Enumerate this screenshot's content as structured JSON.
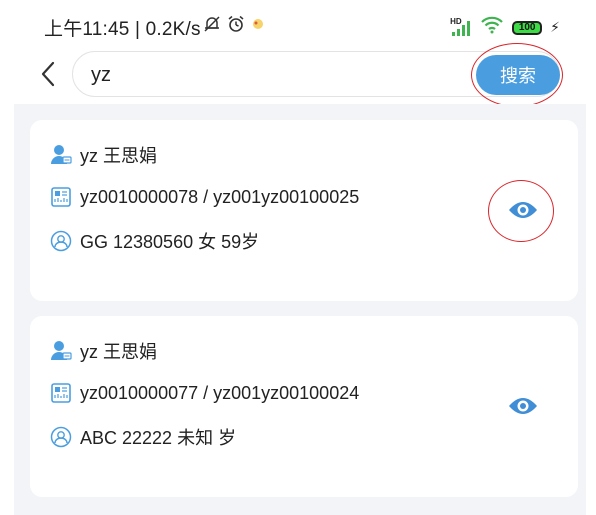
{
  "status_bar": {
    "text": "上午11:45 | 0.2K/s",
    "battery": "100",
    "icons": [
      "mute-bell-icon",
      "alarm-icon",
      "app-notification-icon",
      "hd-signal-icon",
      "wifi-icon",
      "battery-icon",
      "charging-icon"
    ]
  },
  "search": {
    "query": "yz",
    "button_label": "搜索"
  },
  "accent_color": "#4a9ee0",
  "results": [
    {
      "name": "yz  王思娟",
      "ids": "yz0010000078 / yz001yz00100025",
      "details": "GG  12380560  女  59岁"
    },
    {
      "name": "yz  王思娟",
      "ids": "yz0010000077 / yz001yz00100024",
      "details": "ABC  22222  未知  岁"
    }
  ]
}
